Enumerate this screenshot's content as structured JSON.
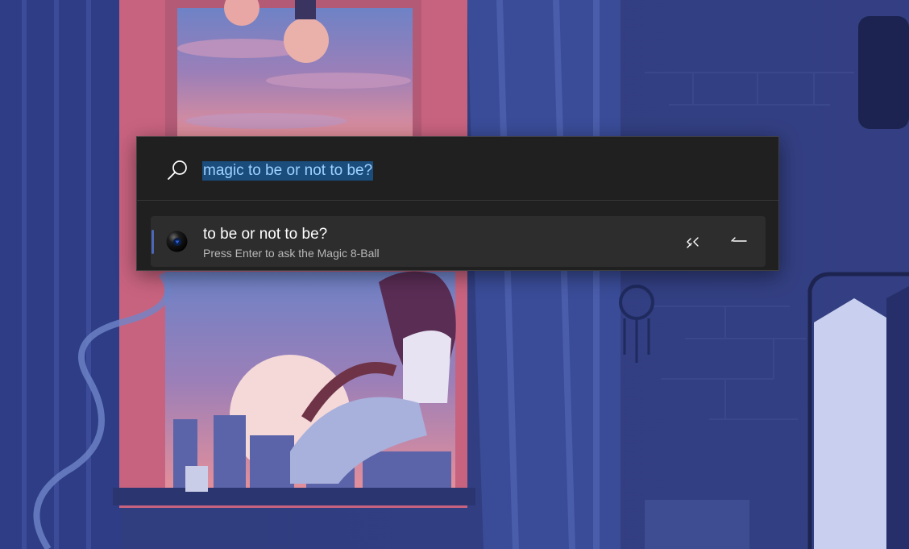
{
  "search": {
    "query": "magic to be or not to be?",
    "icon": "search-icon"
  },
  "results": [
    {
      "title": "to be or not to be?",
      "subtitle": "Press Enter to ask the Magic 8-Ball",
      "icon": "magic-8-ball-icon",
      "actions": [
        "collapse-icon",
        "pin-icon"
      ]
    }
  ],
  "colors": {
    "launcher_bg": "#202020",
    "result_bg": "#2d2d2d",
    "selection_bg": "#1a4c7c",
    "selection_text": "#9fd2ff",
    "accent_indicator": "#4c67b5"
  }
}
